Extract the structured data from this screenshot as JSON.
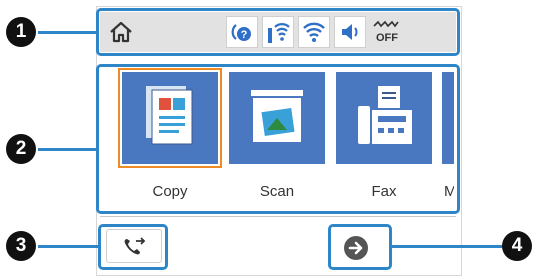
{
  "status_bar": {
    "home_icon": "home-icon",
    "icons": [
      "help-icon",
      "wifi-direct-icon",
      "wifi-icon",
      "sound-icon",
      "quiet-mode-off-icon"
    ],
    "quiet_label": "OFF"
  },
  "menu": {
    "items": [
      {
        "label": "Copy",
        "icon": "copy-icon",
        "selected": true
      },
      {
        "label": "Scan",
        "icon": "scan-icon",
        "selected": false
      },
      {
        "label": "Fax",
        "icon": "fax-icon",
        "selected": false
      },
      {
        "label": "M",
        "icon": "partial-tile",
        "selected": false
      }
    ]
  },
  "bottom": {
    "left_button_icon": "fax-redial-icon",
    "next_icon": "arrow-right-icon"
  },
  "callouts": [
    "1",
    "2",
    "3",
    "4"
  ],
  "colors": {
    "callout_blue": "#2e86c8",
    "tile_blue": "#4a78c0",
    "selection_orange": "#f08a24",
    "status_bar_gray": "#e2e2e2"
  }
}
